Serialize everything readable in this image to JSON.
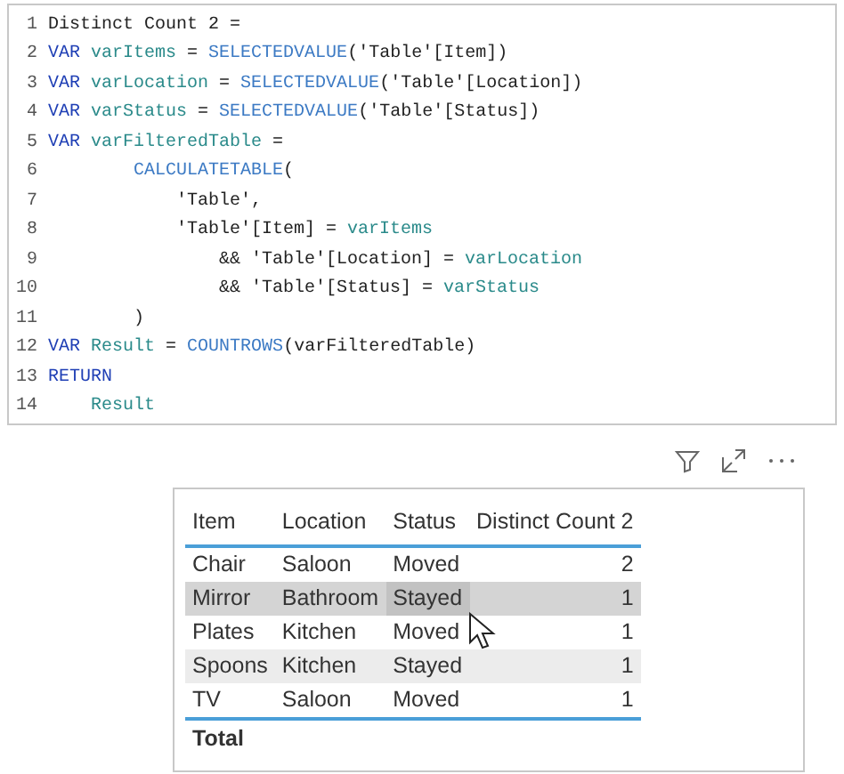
{
  "editor": {
    "lines": [
      {
        "number": "1",
        "tokens": [
          {
            "kind": "plain",
            "text": "Distinct Count 2 ="
          }
        ]
      },
      {
        "number": "2",
        "tokens": [
          {
            "kind": "keyword",
            "text": "VAR"
          },
          {
            "kind": "variable",
            "text": " varItems "
          },
          {
            "kind": "plain",
            "text": "= "
          },
          {
            "kind": "function",
            "text": "SELECTEDVALUE"
          },
          {
            "kind": "plain",
            "text": "('Table'[Item])"
          }
        ]
      },
      {
        "number": "3",
        "tokens": [
          {
            "kind": "keyword",
            "text": "VAR"
          },
          {
            "kind": "variable",
            "text": " varLocation "
          },
          {
            "kind": "plain",
            "text": "= "
          },
          {
            "kind": "function",
            "text": "SELECTEDVALUE"
          },
          {
            "kind": "plain",
            "text": "('Table'[Location])"
          }
        ]
      },
      {
        "number": "4",
        "tokens": [
          {
            "kind": "keyword",
            "text": "VAR"
          },
          {
            "kind": "variable",
            "text": " varStatus "
          },
          {
            "kind": "plain",
            "text": "= "
          },
          {
            "kind": "function",
            "text": "SELECTEDVALUE"
          },
          {
            "kind": "plain",
            "text": "('Table'[Status])"
          }
        ]
      },
      {
        "number": "5",
        "tokens": [
          {
            "kind": "keyword",
            "text": "VAR"
          },
          {
            "kind": "variable",
            "text": " varFilteredTable "
          },
          {
            "kind": "plain",
            "text": "="
          }
        ]
      },
      {
        "number": "6",
        "tokens": [
          {
            "kind": "function",
            "text": "        CALCULATETABLE"
          },
          {
            "kind": "plain",
            "text": "("
          }
        ]
      },
      {
        "number": "7",
        "tokens": [
          {
            "kind": "plain",
            "text": "            'Table',"
          }
        ]
      },
      {
        "number": "8",
        "tokens": [
          {
            "kind": "plain",
            "text": "            'Table'[Item] = "
          },
          {
            "kind": "variable",
            "text": "varItems"
          }
        ]
      },
      {
        "number": "9",
        "tokens": [
          {
            "kind": "plain",
            "text": "                && 'Table'[Location] = "
          },
          {
            "kind": "variable",
            "text": "varLocation"
          }
        ]
      },
      {
        "number": "10",
        "tokens": [
          {
            "kind": "plain",
            "text": "                && 'Table'[Status] = "
          },
          {
            "kind": "variable",
            "text": "varStatus"
          }
        ]
      },
      {
        "number": "11",
        "tokens": [
          {
            "kind": "plain",
            "text": "        )"
          }
        ]
      },
      {
        "number": "12",
        "tokens": [
          {
            "kind": "keyword",
            "text": "VAR"
          },
          {
            "kind": "variable",
            "text": " Result "
          },
          {
            "kind": "plain",
            "text": "= "
          },
          {
            "kind": "function",
            "text": "COUNTROWS"
          },
          {
            "kind": "plain",
            "text": "(varFilteredTable)"
          }
        ]
      },
      {
        "number": "13",
        "tokens": [
          {
            "kind": "keyword",
            "text": "RETURN"
          }
        ]
      },
      {
        "number": "14",
        "tokens": [
          {
            "kind": "variable",
            "text": "    Result"
          }
        ]
      }
    ]
  },
  "table": {
    "columns": [
      "Item",
      "Location",
      "Status",
      "Distinct Count 2"
    ],
    "rows": [
      {
        "cells": [
          "Chair",
          "Saloon",
          "Moved",
          "2"
        ],
        "selected": false
      },
      {
        "cells": [
          "Mirror",
          "Bathroom",
          "Stayed",
          "1"
        ],
        "selected": true
      },
      {
        "cells": [
          "Plates",
          "Kitchen",
          "Moved",
          "1"
        ],
        "selected": false
      },
      {
        "cells": [
          "Spoons",
          "Kitchen",
          "Stayed",
          "1"
        ],
        "selected": false
      },
      {
        "cells": [
          "TV",
          "Saloon",
          "Moved",
          "1"
        ],
        "selected": false
      }
    ],
    "total": {
      "label": "Total"
    }
  }
}
